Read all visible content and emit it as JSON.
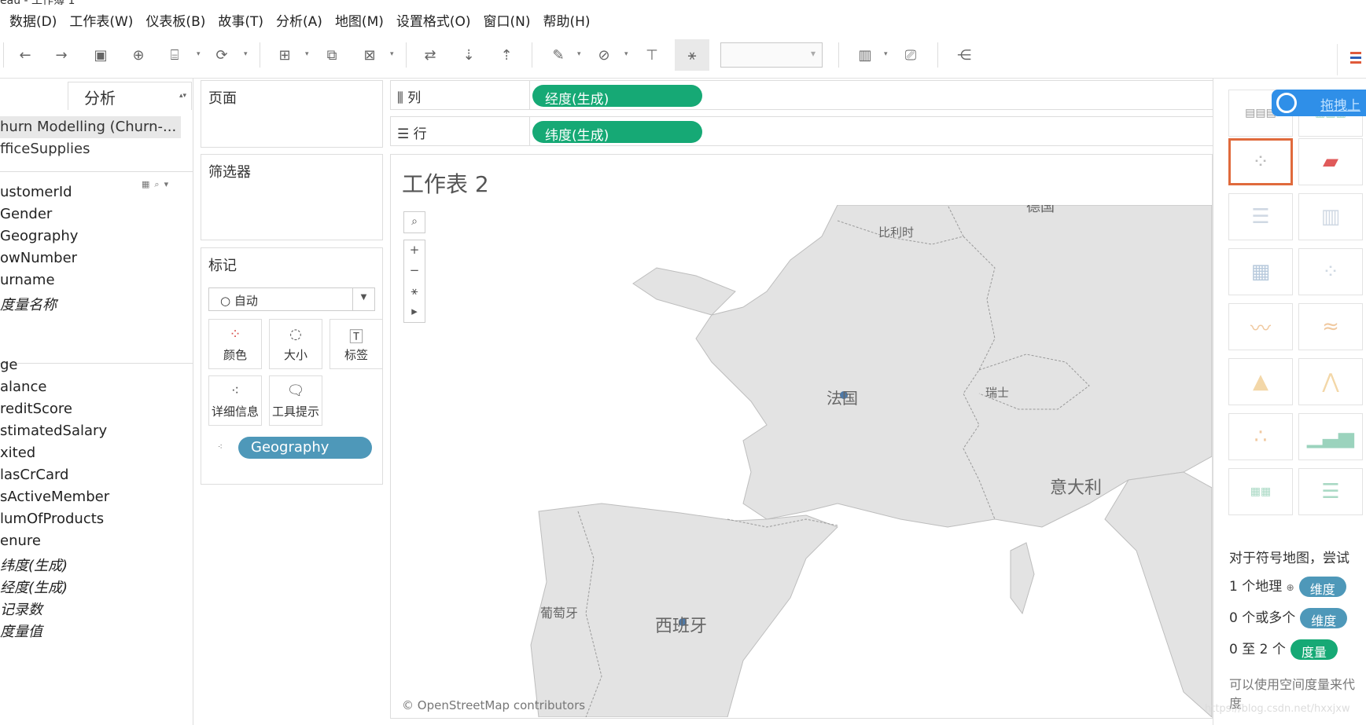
{
  "window": {
    "title_fragment": "eau - 工作簿 1"
  },
  "menu": [
    "数据(D)",
    "工作表(W)",
    "仪表板(B)",
    "故事(T)",
    "分析(A)",
    "地图(M)",
    "设置格式(O)",
    "窗口(N)",
    "帮助(H)"
  ],
  "toolbar": {
    "icons": [
      "back-icon",
      "forward-icon",
      "save-icon",
      "new-datasource-icon",
      "pause-update-icon",
      "refresh-icon",
      "new-worksheet-icon",
      "duplicate-icon",
      "clear-sheet-icon",
      "swap-icon",
      "sort-asc-icon",
      "sort-desc-icon",
      "highlight-icon",
      "group-icon",
      "label-icon",
      "fix-axes-icon",
      "presentation-icon",
      "device-icon",
      "share-icon"
    ]
  },
  "data_pane": {
    "tab": "分析",
    "datasources": [
      "hurn Modelling (Churn-...",
      "fficeSupplies"
    ],
    "dimensions": [
      "ustomerId",
      "Gender",
      "Geography",
      "owNumber",
      "urname",
      "度量名称"
    ],
    "measures": [
      "ge",
      "alance",
      "reditScore",
      "stimatedSalary",
      "xited",
      "lasCrCard",
      "sActiveMember",
      "lumOfProducts",
      "enure",
      "纬度(生成)",
      "经度(生成)",
      "记录数",
      "度量值"
    ]
  },
  "pages": {
    "title": "页面"
  },
  "filters": {
    "title": "筛选器"
  },
  "marks": {
    "title": "标记",
    "type": "自动",
    "buttons": [
      "颜色",
      "大小",
      "标签",
      "详细信息",
      "工具提示"
    ],
    "detail_pill": "Geography"
  },
  "shelves": {
    "columns_label": "列",
    "columns_pill": "经度(生成)",
    "rows_label": "行",
    "rows_pill": "纬度(生成)"
  },
  "sheet": {
    "title": "工作表 2",
    "credit": "© OpenStreetMap contributors",
    "labels": [
      "比利时",
      "法国",
      "瑞士",
      "意大利",
      "葡萄牙",
      "西班牙",
      "德国"
    ]
  },
  "show_me": {
    "badge": "拖拽上",
    "hint_title": "对于符号地图，尝试",
    "rows": [
      {
        "text": "1 个地理",
        "pill": "维度",
        "kind": "dim"
      },
      {
        "text": "0 个或多个",
        "pill": "维度",
        "kind": "dim"
      },
      {
        "text": "0 至 2 个",
        "pill": "度量",
        "kind": "meas"
      }
    ],
    "footer": "可以使用空间度量来代 度"
  },
  "watermark": "https://blog.csdn.net/hxxjxw",
  "colors": {
    "dimension_pill": "#4e98b9",
    "measure_pill": "#16a975",
    "selected_border": "#e06a3c",
    "map_land": "#e2e2e2",
    "map_sea": "#ffffff"
  }
}
